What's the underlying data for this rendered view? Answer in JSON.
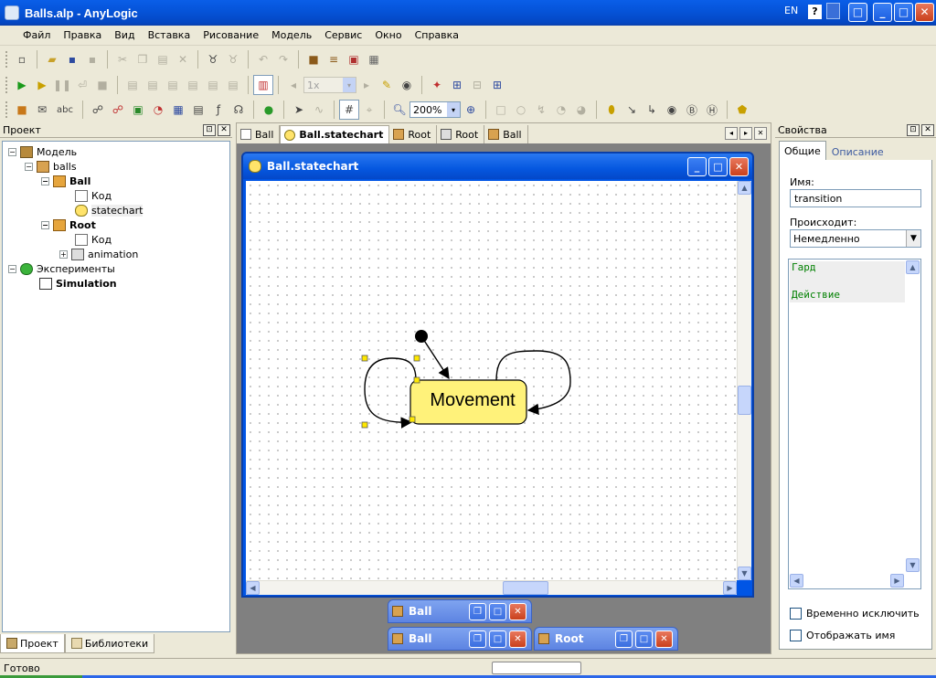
{
  "window": {
    "title": "Balls.alp - AnyLogic",
    "language": "EN",
    "help": "?",
    "buttons": {
      "minimize": "_",
      "maximize": "□",
      "close": "✕"
    }
  },
  "menu": [
    "Файл",
    "Правка",
    "Вид",
    "Вставка",
    "Рисование",
    "Модель",
    "Сервис",
    "Окно",
    "Справка"
  ],
  "toolbar": {
    "speed_value": "1x",
    "zoom_value": "200%",
    "text_tool_label": "abc"
  },
  "project_panel": {
    "title": "Проект",
    "tree": {
      "model": "Модель",
      "balls": "balls",
      "ball": "Ball",
      "ball_code": "Код",
      "ball_statechart": "statechart",
      "root": "Root",
      "root_code": "Код",
      "root_animation": "animation",
      "experiments": "Эксперименты",
      "simulation": "Simulation"
    },
    "tabs": {
      "project": "Проект",
      "libraries": "Библиотеки"
    }
  },
  "editor": {
    "tabs": [
      "Ball",
      "Ball.statechart",
      "Root",
      "Root",
      "Ball"
    ],
    "active_tab_index": 1,
    "window_title": "Ball.statechart",
    "state_label": "Movement",
    "minimized": [
      "Ball",
      "Ball",
      "Root"
    ]
  },
  "properties": {
    "title": "Свойства",
    "tabs": {
      "general": "Общие",
      "description": "Описание"
    },
    "name_label": "Имя:",
    "name_value": "transition",
    "occurs_label": "Происходит:",
    "occurs_value": "Немедленно",
    "code_lines": {
      "guard": "Гард",
      "action": "Действие"
    },
    "checkboxes": {
      "exclude": "Временно исключить",
      "show_name": "Отображать имя"
    }
  },
  "status": {
    "text": "Готово"
  },
  "colors": {
    "title_bar": "#0553d8",
    "state_fill": "#fff27a",
    "code_text": "#008000"
  }
}
